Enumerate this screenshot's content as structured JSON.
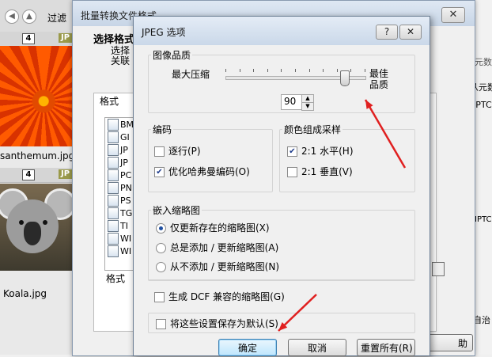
{
  "background": {
    "toolbar": {
      "filter_label": "过滤"
    },
    "thumbs": [
      {
        "badge": "4",
        "type": "JP",
        "filename": "santhemum.jpg"
      },
      {
        "badge": "4",
        "type": "JP",
        "filename": "Koala.jpg"
      }
    ],
    "right_panel": {
      "text1": "元数",
      "text2": "从元数",
      "text3": "IPTC",
      "text4": "IPTC",
      "text5": "自治"
    }
  },
  "batch_window": {
    "title": "批量转换文件格式",
    "close_glyph": "✕",
    "choose_format": "选择格式",
    "choose_sub1": "选择",
    "choose_sub2": "关联",
    "format_group_label": "格式",
    "format_items": [
      "BM",
      "GI",
      "JP",
      "JP",
      "PC",
      "PN",
      "PS",
      "TG",
      "TI",
      "WI",
      "WI"
    ],
    "format_column_label": "格式",
    "help_label": "助"
  },
  "jpeg_dialog": {
    "title": "JPEG 选项",
    "help_glyph": "?",
    "close_glyph": "✕",
    "quality": {
      "title": "图像品质",
      "min_label": "最大压缩",
      "max_label_line1": "最佳",
      "max_label_line2": "品质",
      "value": "90",
      "slider_fraction": 0.9
    },
    "encoding": {
      "title": "编码",
      "progressive": {
        "label": "逐行(P)",
        "checked": false
      },
      "optimize_huffman": {
        "label": "优化哈弗曼编码(O)",
        "checked": true
      }
    },
    "sampling": {
      "title": "颜色组成采样",
      "h21": {
        "label": "2:1 水平(H)",
        "checked": true
      },
      "v21": {
        "label": "2:1 垂直(V)",
        "checked": false
      }
    },
    "thumbnail": {
      "title": "嵌入缩略图",
      "options": [
        {
          "label": "仅更新存在的缩略图(X)",
          "selected": true
        },
        {
          "label": "总是添加 / 更新缩略图(A)",
          "selected": false
        },
        {
          "label": "从不添加 / 更新缩略图(N)",
          "selected": false
        }
      ],
      "dcf": {
        "label": "生成 DCF 兼容的缩略图(G)",
        "checked": false
      }
    },
    "save_default": {
      "label": "将这些设置保存为默认(S)",
      "checked": false
    },
    "buttons": {
      "ok": "确定",
      "cancel": "取消",
      "reset": "重置所有(R)"
    }
  },
  "colors": {
    "annotation_arrow": "#e02020",
    "title_gradient_top": "#e4ecf6",
    "ok_border": "#3c7fb1"
  }
}
